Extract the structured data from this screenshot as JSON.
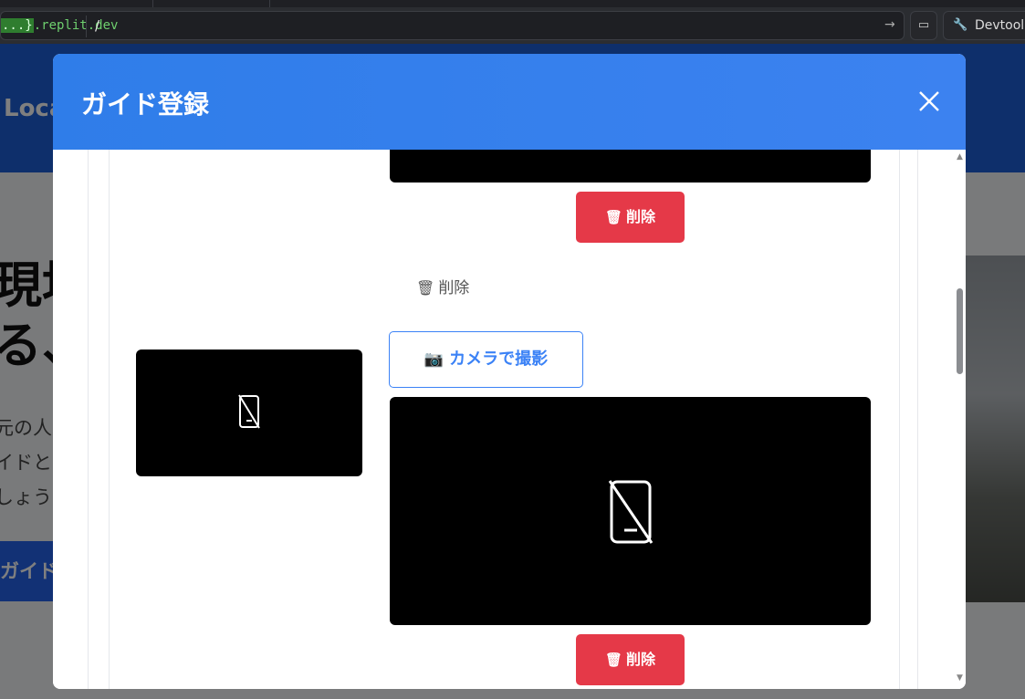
{
  "browser": {
    "url_domain_prefix": "...}",
    "url_domain_suffix": ".replit.dev",
    "url_path": "/",
    "go_icon": "arrow-right-icon",
    "devtools_label": "Devtools"
  },
  "background_page": {
    "logo_text": "Loca",
    "hero_title_line1": "現地",
    "hero_title_line2": "る、",
    "hero_text_line1": "元の人",
    "hero_text_line2": "イドと",
    "hero_text_line3": "しょう",
    "cta_label": "ガイド"
  },
  "modal": {
    "title": "ガイド登録",
    "close_icon": "close-icon",
    "delete_button_top": "削除",
    "delete_text_link": "削除",
    "camera_button": "カメラで撮影",
    "delete_button_bottom": "削除",
    "video_placeholder_icon": "no-mobile-device-icon"
  },
  "colors": {
    "header_blue": "#2f7de9",
    "danger_red": "#e53948",
    "camera_blue": "#3b82f6"
  }
}
